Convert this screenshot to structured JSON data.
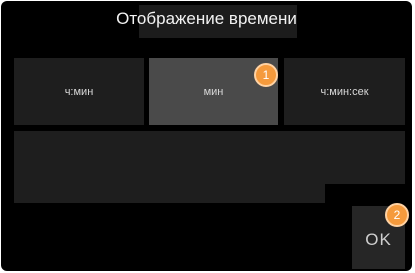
{
  "dialog": {
    "title": "Отображение времени"
  },
  "options": [
    {
      "label": "ч:мин",
      "selected": false
    },
    {
      "label": "мин",
      "selected": true
    },
    {
      "label": "ч:мин:сек",
      "selected": false
    }
  ],
  "ok_button": {
    "label": "OK"
  },
  "markers": [
    {
      "number": "1"
    },
    {
      "number": "2"
    }
  ],
  "colors": {
    "background": "#000000",
    "option_bg": "#1e1e1e",
    "selected_bg": "#4a4a4a",
    "marker": "#f59a3c"
  }
}
